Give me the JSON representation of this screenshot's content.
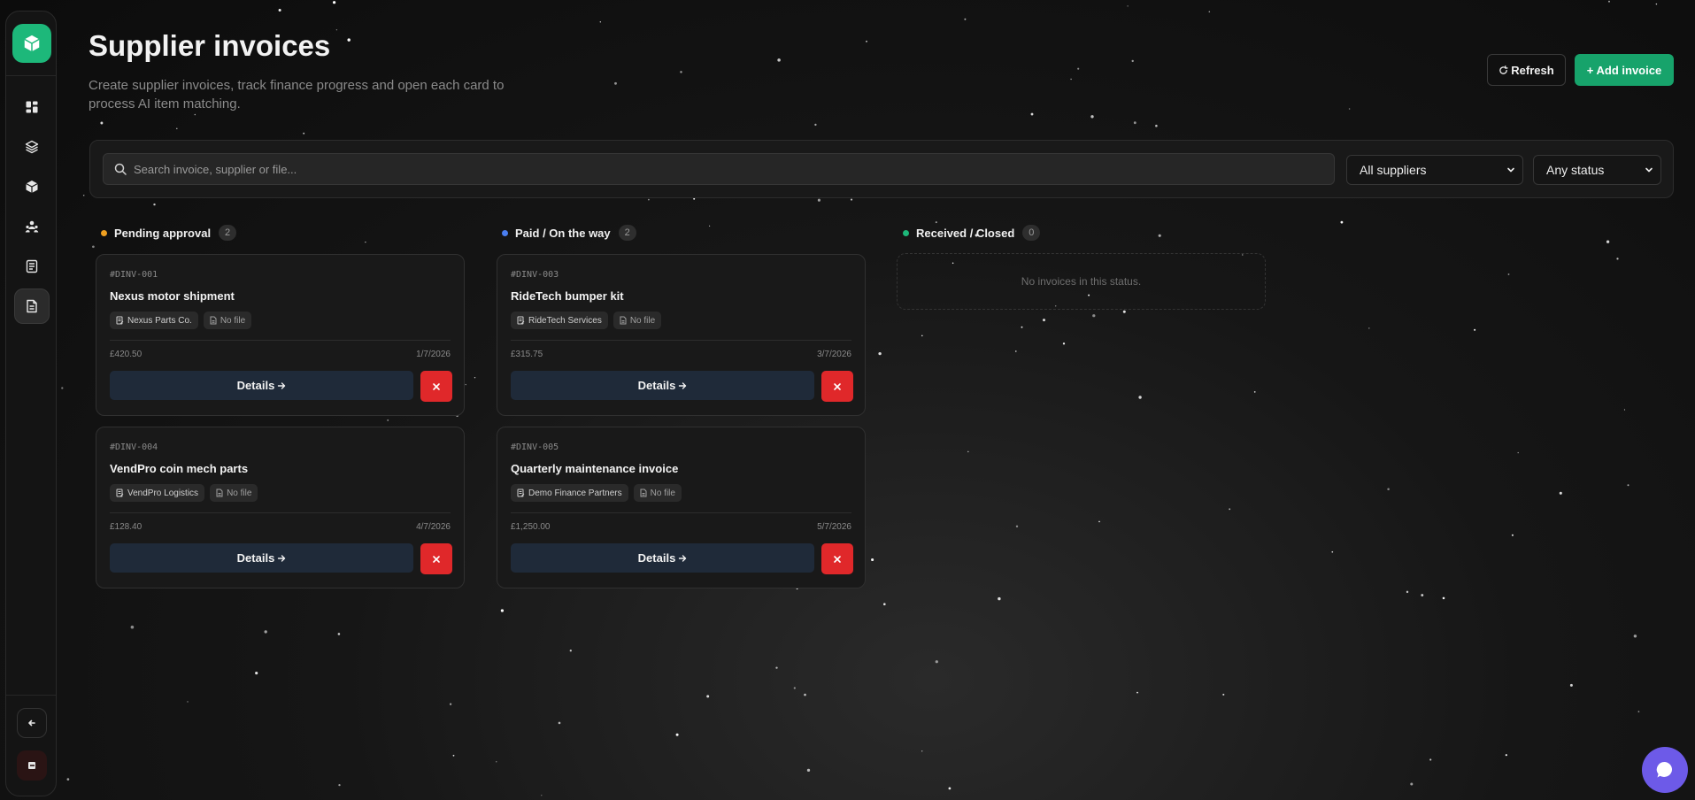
{
  "header": {
    "title": "Supplier invoices",
    "subtitle": "Create supplier invoices, track finance progress and open each card to process AI item matching.",
    "refresh_label": "Refresh",
    "add_label": "+ Add invoice"
  },
  "sidebar": {
    "items": [
      {
        "icon": "dashboard-icon"
      },
      {
        "icon": "layers-icon"
      },
      {
        "icon": "box-icon"
      },
      {
        "icon": "users-icon"
      },
      {
        "icon": "document-icon"
      },
      {
        "icon": "invoice-icon",
        "active": true
      }
    ]
  },
  "filters": {
    "search_placeholder": "Search invoice, supplier or file...",
    "supplier_selected": "All suppliers",
    "status_selected": "Any status"
  },
  "columns": [
    {
      "title": "Pending approval",
      "count": "2",
      "color": "#f0a020",
      "cards": [
        {
          "id": "#DINV-001",
          "title": "Nexus motor shipment",
          "supplier": "Nexus Parts Co.",
          "file": "No file",
          "amount": "£420.50",
          "date": "1/7/2026",
          "details_label": "Details"
        },
        {
          "id": "#DINV-004",
          "title": "VendPro coin mech parts",
          "supplier": "VendPro Logistics",
          "file": "No file",
          "amount": "£128.40",
          "date": "4/7/2026",
          "details_label": "Details"
        }
      ]
    },
    {
      "title": "Paid / On the way",
      "count": "2",
      "color": "#4a7ef0",
      "cards": [
        {
          "id": "#DINV-003",
          "title": "RideTech bumper kit",
          "supplier": "RideTech Services",
          "file": "No file",
          "amount": "£315.75",
          "date": "3/7/2026",
          "details_label": "Details"
        },
        {
          "id": "#DINV-005",
          "title": "Quarterly maintenance invoice",
          "supplier": "Demo Finance Partners",
          "file": "No file",
          "amount": "£1,250.00",
          "date": "5/7/2026",
          "details_label": "Details"
        }
      ]
    },
    {
      "title": "Received / Closed",
      "count": "0",
      "color": "#1db87a",
      "empty_text": "No invoices in this status."
    }
  ],
  "colors": {
    "accent": "#17a36b",
    "danger": "#e0282a",
    "chat": "#6d5ae8"
  }
}
